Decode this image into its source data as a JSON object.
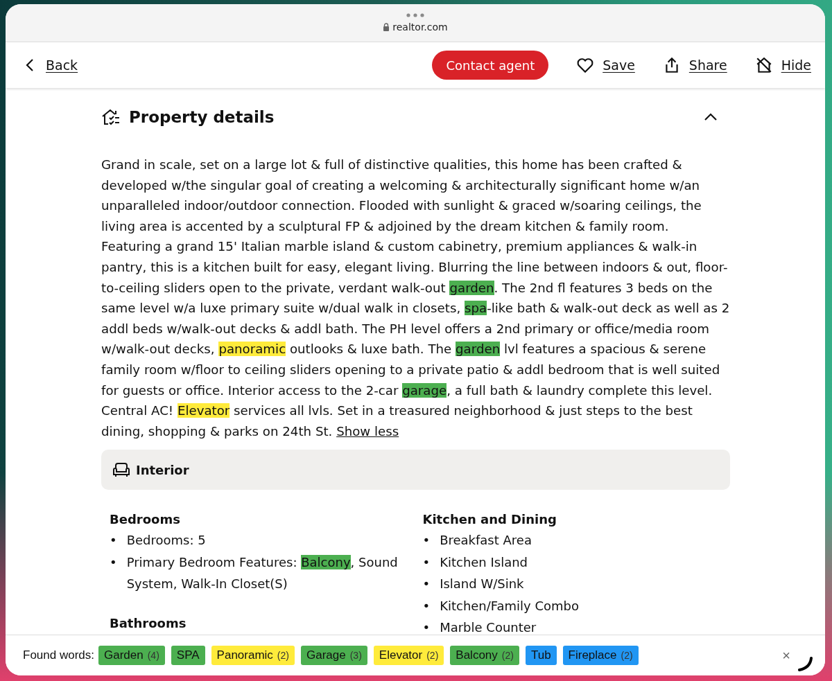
{
  "browser": {
    "address": "realtor.com"
  },
  "nav": {
    "back": "Back",
    "contact": "Contact agent",
    "actions": [
      {
        "kind": "save",
        "label": "Save"
      },
      {
        "kind": "share",
        "label": "Share"
      },
      {
        "kind": "hide",
        "label": "Hide"
      }
    ]
  },
  "section": {
    "title": "Property details",
    "expanded": true,
    "description": [
      {
        "text": "Grand in scale, set on a large lot & full of distinctive qualities, this home has been crafted & developed w/the singular goal of creating a welcoming & architecturally significant home w/an unparalleled indoor/outdoor connection. Flooded with sunlight & graced w/soaring ceilings, the living area is accented by a sculptural FP & adjoined by the dream kitchen & family room. Featuring a grand 15' Italian marble island & custom cabinetry, premium appliances & walk-in pantry, this is a kitchen built for easy, elegant living. Blurring the line between indoors & out, floor-to-ceiling sliders open to the private, verdant walk-out "
      },
      {
        "text": "garden",
        "color": "#4caf50"
      },
      {
        "text": ". The 2nd fl features 3 beds on the same level w/a luxe primary suite w/dual walk in closets, "
      },
      {
        "text": "spa",
        "color": "#4caf50"
      },
      {
        "text": "-like bath & walk-out deck as well as 2 addl beds w/walk-out decks & addl bath. The PH level offers a 2nd primary or office/media room w/walk-out decks, "
      },
      {
        "text": "panoramic",
        "color": "#ffeb3b"
      },
      {
        "text": " outlooks & luxe bath. The "
      },
      {
        "text": "garden",
        "color": "#4caf50"
      },
      {
        "text": " lvl features a spacious & serene family room w/floor to ceiling sliders opening to a private patio & addl bedroom that is well suited for guests or office. Interior access to the 2-car "
      },
      {
        "text": "garage",
        "color": "#4caf50"
      },
      {
        "text": ", a full bath & laundry complete this level. Central AC! "
      },
      {
        "text": "Elevator",
        "color": "#ffeb3b"
      },
      {
        "text": " services all lvls. Set in a treasured neighborhood & just steps to the best dining, shopping & parks on 24th St. "
      }
    ],
    "show_less": "Show less"
  },
  "interior": {
    "title": "Interior",
    "columns": [
      [
        {
          "heading": "Bedrooms",
          "marker": "•",
          "items": [
            [
              {
                "text": "Bedrooms: 5"
              }
            ],
            [
              {
                "text": "Primary Bedroom Features: "
              },
              {
                "text": "Balcony",
                "color": "#4caf50"
              },
              {
                "text": ", Sound System, Walk-In Closet(S)"
              }
            ]
          ]
        },
        {
          "heading": "Bathrooms"
        }
      ],
      [
        {
          "heading": "Kitchen and Dining",
          "marker": "•",
          "items": [
            [
              {
                "text": "Breakfast Area"
              }
            ],
            [
              {
                "text": "Kitchen Island"
              }
            ],
            [
              {
                "text": "Island W/Sink"
              }
            ],
            [
              {
                "text": "Kitchen/Family Combo"
              }
            ],
            [
              {
                "text": "Marble Counter"
              }
            ]
          ]
        }
      ]
    ]
  },
  "found_words": {
    "label": "Found words:",
    "chips": [
      {
        "word": "Garden",
        "count": "(4)",
        "color": "#4caf50"
      },
      {
        "word": "SPA",
        "color": "#4caf50"
      },
      {
        "word": "Panoramic",
        "count": "(2)",
        "color": "#ffeb3b"
      },
      {
        "word": "Garage",
        "count": "(3)",
        "color": "#4caf50"
      },
      {
        "word": "Elevator",
        "count": "(2)",
        "color": "#ffeb3b"
      },
      {
        "word": "Balcony",
        "count": "(2)",
        "color": "#4caf50"
      },
      {
        "word": "Tub",
        "color": "#2196f3"
      },
      {
        "word": "Fireplace",
        "count": "(2)",
        "color": "#2196f3"
      }
    ],
    "close": "×"
  }
}
